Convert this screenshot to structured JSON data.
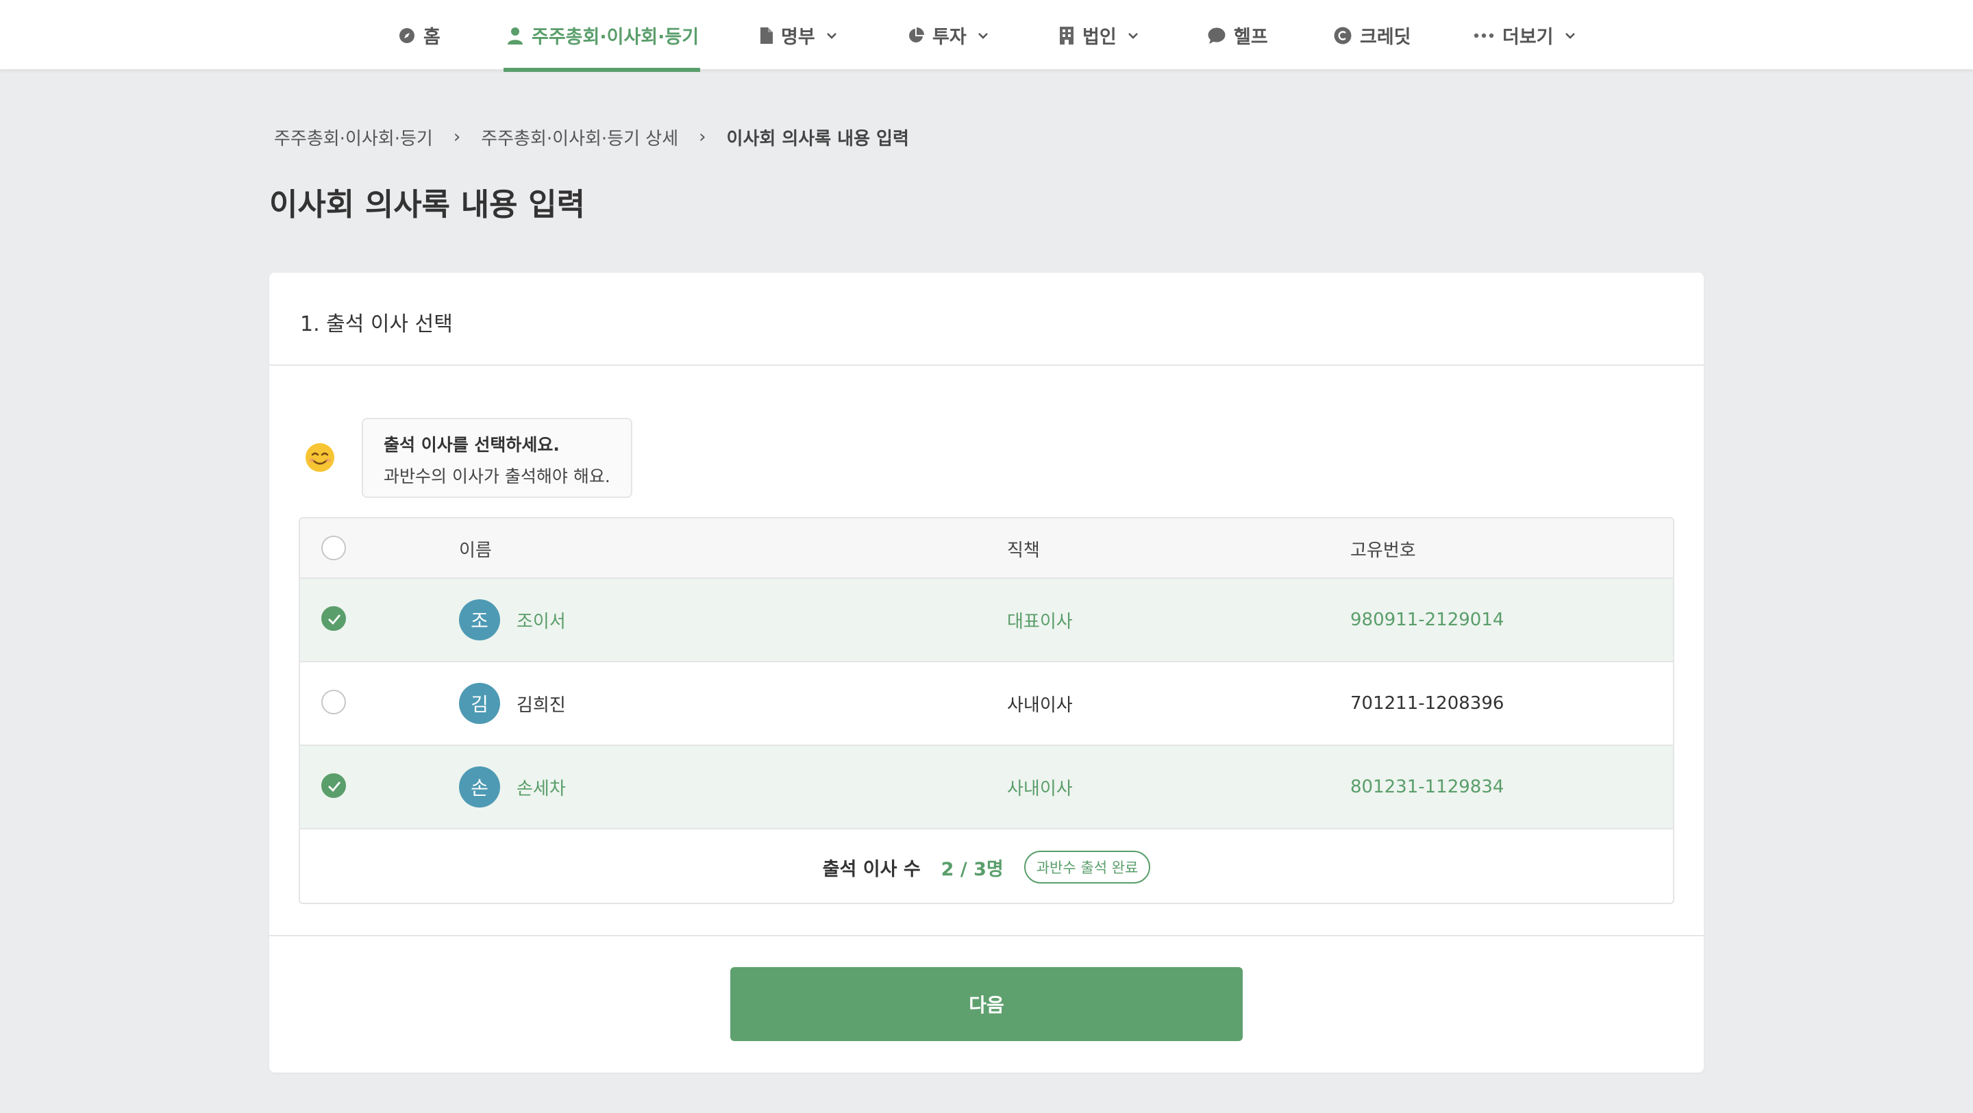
{
  "nav": {
    "home": "홈",
    "meetings": "주주총회·이사회·등기",
    "registry": "명부",
    "investment": "투자",
    "corporation": "법인",
    "help": "헬프",
    "credit": "크레딧",
    "more": "더보기"
  },
  "breadcrumb": {
    "item1": "주주총회·이사회·등기",
    "item2": "주주총회·이사회·등기 상세",
    "current": "이사회 의사록 내용 입력",
    "separator": "›"
  },
  "page_title": "이사회 의사록 내용 입력",
  "section": {
    "title": "1. 출석 이사 선택",
    "guide_line1": "출석 이사를 선택하세요.",
    "guide_line2": "과반수의 이사가 출석해야 해요."
  },
  "table": {
    "headers": {
      "name": "이름",
      "position": "직책",
      "id_number": "고유번호"
    },
    "rows": [
      {
        "selected": true,
        "initial": "조",
        "name": "조이서",
        "position": "대표이사",
        "id_number": "980911-2129014"
      },
      {
        "selected": false,
        "initial": "김",
        "name": "김희진",
        "position": "사내이사",
        "id_number": "701211-1208396"
      },
      {
        "selected": true,
        "initial": "손",
        "name": "손세차",
        "position": "사내이사",
        "id_number": "801231-1129834"
      }
    ],
    "footer": {
      "count_label": "출석 이사 수",
      "count_value": "2 / 3명",
      "badge": "과반수 출석 완료"
    }
  },
  "next_button": "다음",
  "colors": {
    "accent": "#5a9e6b",
    "avatar": "#4e9ab4",
    "selected_row": "#eef4ef",
    "background": "#ebecee"
  }
}
